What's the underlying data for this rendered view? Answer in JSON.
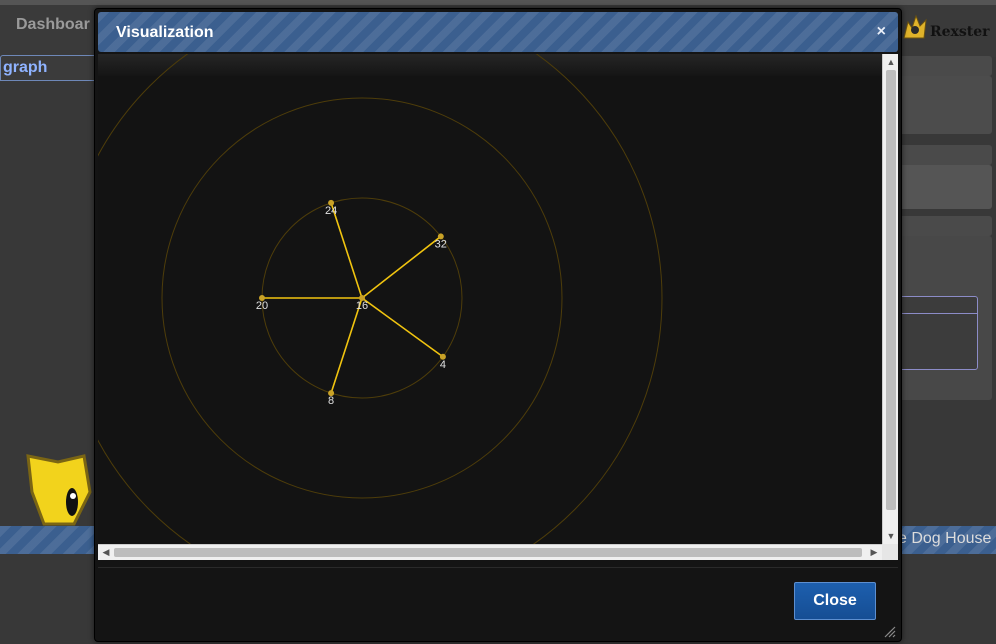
{
  "background": {
    "nav_tab": "Dashboar",
    "graph_tab": "graph",
    "logo_text": "Rexster",
    "footer_text": "e Dog House"
  },
  "dialog": {
    "title": "Visualization",
    "close_x": "×",
    "close_button": "Close"
  },
  "graph": {
    "center": "16",
    "nodes": [
      {
        "label": "24",
        "angle_deg": 252
      },
      {
        "label": "32",
        "angle_deg": 322
      },
      {
        "label": "4",
        "angle_deg": 36
      },
      {
        "label": "8",
        "angle_deg": 108
      },
      {
        "label": "20",
        "angle_deg": 180
      }
    ],
    "ring_count": 3,
    "colors": {
      "edge": "#f1c40f",
      "node": "#c9a227",
      "ring": "#4e3d0a",
      "label": "#e0e0e0"
    }
  },
  "icons": {
    "close": "close-icon",
    "scroll_up": "scroll-up-icon",
    "scroll_down": "scroll-down-icon",
    "scroll_left": "scroll-left-icon",
    "scroll_right": "scroll-right-icon",
    "resize": "resize-grip-icon",
    "logo": "rexster-logo-icon",
    "mascot": "dog-mascot-icon"
  },
  "colors": {
    "titlebar": "#3b5f8f",
    "button": "#1d5fae",
    "dialog_bg": "#141414"
  }
}
